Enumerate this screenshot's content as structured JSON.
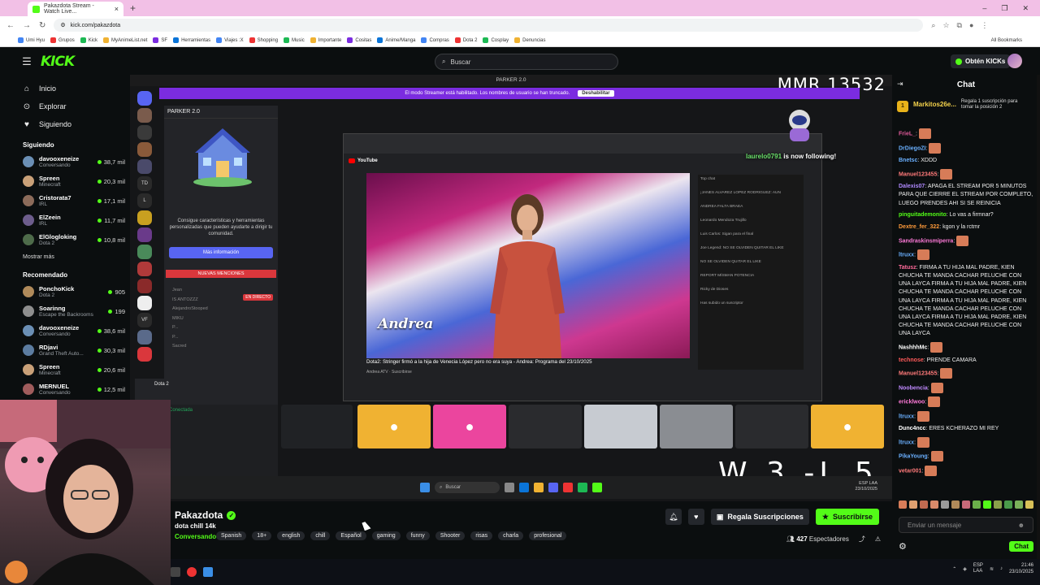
{
  "browser": {
    "tab_title": "Pakazdota Stream - Watch Live...",
    "url": "kick.com/pakazdota",
    "bookmarks": [
      "Umi Hyu",
      "Grupos",
      "Kick",
      "MyAnimeList.net",
      "SF",
      "Herramientas",
      "Viajes :X",
      "Shopping",
      "Music",
      "Importante",
      "Cositas",
      "Anime/Manga",
      "Compras",
      "Dota 2",
      "Cosplay",
      "Denuncias"
    ],
    "all_bookmarks": "All Bookmarks"
  },
  "header": {
    "logo": "KICK",
    "search_placeholder": "Buscar",
    "kicks_button": "Obtén KICKs"
  },
  "sidebar": {
    "nav": [
      {
        "label": "Inicio",
        "icon": "home-icon"
      },
      {
        "label": "Explorar",
        "icon": "compass-icon"
      },
      {
        "label": "Siguiendo",
        "icon": "heart-icon"
      }
    ],
    "following_title": "Siguiendo",
    "following": [
      {
        "name": "davooxeneize",
        "category": "Conversando",
        "viewers": "38,7 mil",
        "color": "#6b8fb5"
      },
      {
        "name": "Spreen",
        "category": "Minecraft",
        "viewers": "20,3 mil",
        "color": "#c9a078"
      },
      {
        "name": "Cristorata7",
        "category": "IRL",
        "viewers": "17,1 mil",
        "color": "#8c6b5a"
      },
      {
        "name": "ElZeein",
        "category": "IRL",
        "viewers": "11,7 mil",
        "color": "#6d5d8c"
      },
      {
        "name": "ElGlogloking",
        "category": "Dota 2",
        "viewers": "10,8 mil",
        "color": "#4e6b4a"
      }
    ],
    "show_more": "Mostrar más",
    "recommended_title": "Recomendado",
    "recommended": [
      {
        "name": "PonchoKick",
        "category": "Dota 2",
        "viewers": "905",
        "color": "#b08a5a"
      },
      {
        "name": "Soarinng",
        "category": "Escape the Backrooms",
        "viewers": "199",
        "color": "#8e8e8e"
      },
      {
        "name": "davooxeneize",
        "category": "Conversando",
        "viewers": "38,6 mil",
        "color": "#6b8fb5"
      },
      {
        "name": "RDjavi",
        "category": "Grand Theft Auto...",
        "viewers": "30,3 mil",
        "color": "#5c7ca0"
      },
      {
        "name": "Spreen",
        "category": "Minecraft",
        "viewers": "20,6 mil",
        "color": "#c9a078"
      },
      {
        "name": "MERNUEL",
        "category": "Conversando",
        "viewers": "12,5 mil",
        "color": "#a05c5c"
      }
    ]
  },
  "stream": {
    "overlay_app": "PARKER 2.0",
    "mmr": "MMR 13532",
    "streamer_mode_text": "El modo Streamer está habilitado. Los nombres de usuario se han truncado.",
    "disable_btn": "Deshabilitar",
    "discord_panel_title": "PARKER 2.0",
    "discord_text": "Consigue características y herramientas personalizadas que pueden ayudarte a dirigir tu comunidad.",
    "discord_more": "Más información",
    "discord_mentions": "NUEVAS MENCIONES",
    "discord_live": "EN DIRECTO",
    "discord_users": [
      "Jean",
      "IS ANTOZZZ",
      "AlejandroStooped",
      "MIKU",
      "P...",
      "P...",
      "Sacred"
    ],
    "dota_label": "Dota 2",
    "voice_connected": "Conectada",
    "yt_logo": "YouTube",
    "video_caption": "Andrea",
    "yt_video_title": "Dota2: Stringer firmó a la hija de Venecia López pero no era suya - Andrea: Programa del 23/10/2025",
    "yt_meta": "Andrea ATV  ·  Suscribirse",
    "yt_chat_lines": [
      "Top chat",
      "¡JANES ALVAREZ LOPEZ RODRIGUEZ: AUN",
      "ANDREA FALTA BRAEA",
      "Leonardo Mendoza Trujillo",
      "Luis Carlos: Sigan para el final",
      "Joe Legend: NO SE OLVIDEN QUITAR EL LIKE",
      "NO SE OLVIDEN QUITAR EL LIKE",
      "REPORT MÍSMAN POTENCIA",
      "Ricky de Dioses",
      "Has subido un suscriptor"
    ],
    "follow_alert_user": "laurelo0791",
    "follow_alert_text": "is now following!",
    "score": "W 3  -L 5",
    "taskbar_search": "Buscar",
    "tray_lang": "ESP LAA",
    "tray_date": "23/10/2025"
  },
  "channel": {
    "name": "Pakazdota",
    "title": "dota chill 14k",
    "category": "Conversando",
    "tags": [
      "Spanish",
      "18+",
      "english",
      "chill",
      "Español",
      "gaming",
      "funny",
      "Shooter",
      "risas",
      "charla",
      "profesional"
    ],
    "gift_button": "Regala Suscripciones",
    "subscribe_button": "Suscribirse",
    "viewers": "427",
    "viewers_label": "Espectadores"
  },
  "chat": {
    "title": "Chat",
    "pinned_user": "Markitos26e...",
    "pinned_rank": "1",
    "pinned_text": "Regala 1 suscripción para tomar la posición 2",
    "messages": [
      {
        "user": "FrieL_",
        "color": "#e05a9a",
        "text": "",
        "emote": true
      },
      {
        "user": "DrDiegoZI",
        "color": "#6ab0ff",
        "text": "",
        "emote": true
      },
      {
        "user": "Bnetsc",
        "color": "#6ab0ff",
        "text": "XDDD",
        "emote": false
      },
      {
        "user": "Manuel123455",
        "color": "#ff7a7a",
        "text": "",
        "emote": true
      },
      {
        "user": "Dalexis07",
        "color": "#b08aff",
        "text": "APAGA EL STREAM POR 5 MINUTOS PARA QUE CIERRE EL STREAM POR COMPLETO, LUEGO PRENDES AHI SI SE REINICIA",
        "emote": false
      },
      {
        "user": "pinguitademonito",
        "color": "#53fc18",
        "text": "Lo vas a firmnar?",
        "emote": false
      },
      {
        "user": "Dextre_fer_322",
        "color": "#ff9a3a",
        "text": "kgon y la rctmr",
        "emote": false
      },
      {
        "user": "Sandraskinsmiperra",
        "color": "#ff7ad9",
        "text": "",
        "emote": true
      },
      {
        "user": "ltruxx",
        "color": "#6ab0ff",
        "text": "",
        "emote": true
      },
      {
        "user": "Tatusz",
        "color": "#ff6a9a",
        "text": "FIRMA A TU HIJA MAL PADRE, KIEN CHUCHA TE MANDA CACHAR PELUCHE CON UNA LAYCA FIRMA A TU HIJA MAL PADRE, KIEN CHUCHA TE MANDA CACHAR PELUCHE CON UNA LAYCA FIRMA A TU HIJA MAL PADRE, KIEN CHUCHA TE MANDA CACHAR PELUCHE CON UNA LAYCA FIRMA A TU HIJA MAL PADRE, KIEN CHUCHA TE MANDA CACHAR PELUCHE CON UNA LAYCA",
        "emote": false
      },
      {
        "user": "NashhhMc",
        "color": "#ffffff",
        "text": "",
        "emote": true
      },
      {
        "user": "technose",
        "color": "#ff5a5a",
        "text": "PRENDE CAMARA",
        "emote": false
      },
      {
        "user": "Manuel123455",
        "color": "#ff7a7a",
        "text": "",
        "emote": true
      },
      {
        "user": "Noobencia",
        "color": "#c08aff",
        "text": "",
        "emote": true
      },
      {
        "user": "ericklwoo",
        "color": "#ff7ad9",
        "text": "",
        "emote": true
      },
      {
        "user": "ltruxx",
        "color": "#6ab0ff",
        "text": "",
        "emote": true
      },
      {
        "user": "Dunc4ncc",
        "color": "#ffffff",
        "text": "ERES KCHERAZO MI REY",
        "emote": false
      },
      {
        "user": "ltruxx",
        "color": "#6ab0ff",
        "text": "",
        "emote": true
      },
      {
        "user": "PikaYoung",
        "color": "#6ab0ff",
        "text": "",
        "emote": true
      },
      {
        "user": "vetar001",
        "color": "#ff7a7a",
        "text": "",
        "emote": true
      }
    ],
    "input_placeholder": "Enviar un mensaje",
    "send_button": "Chat"
  },
  "os": {
    "tray_lang_1": "ESP",
    "tray_lang_2": "LAA",
    "time": "21:46",
    "date": "23/10/2025"
  }
}
